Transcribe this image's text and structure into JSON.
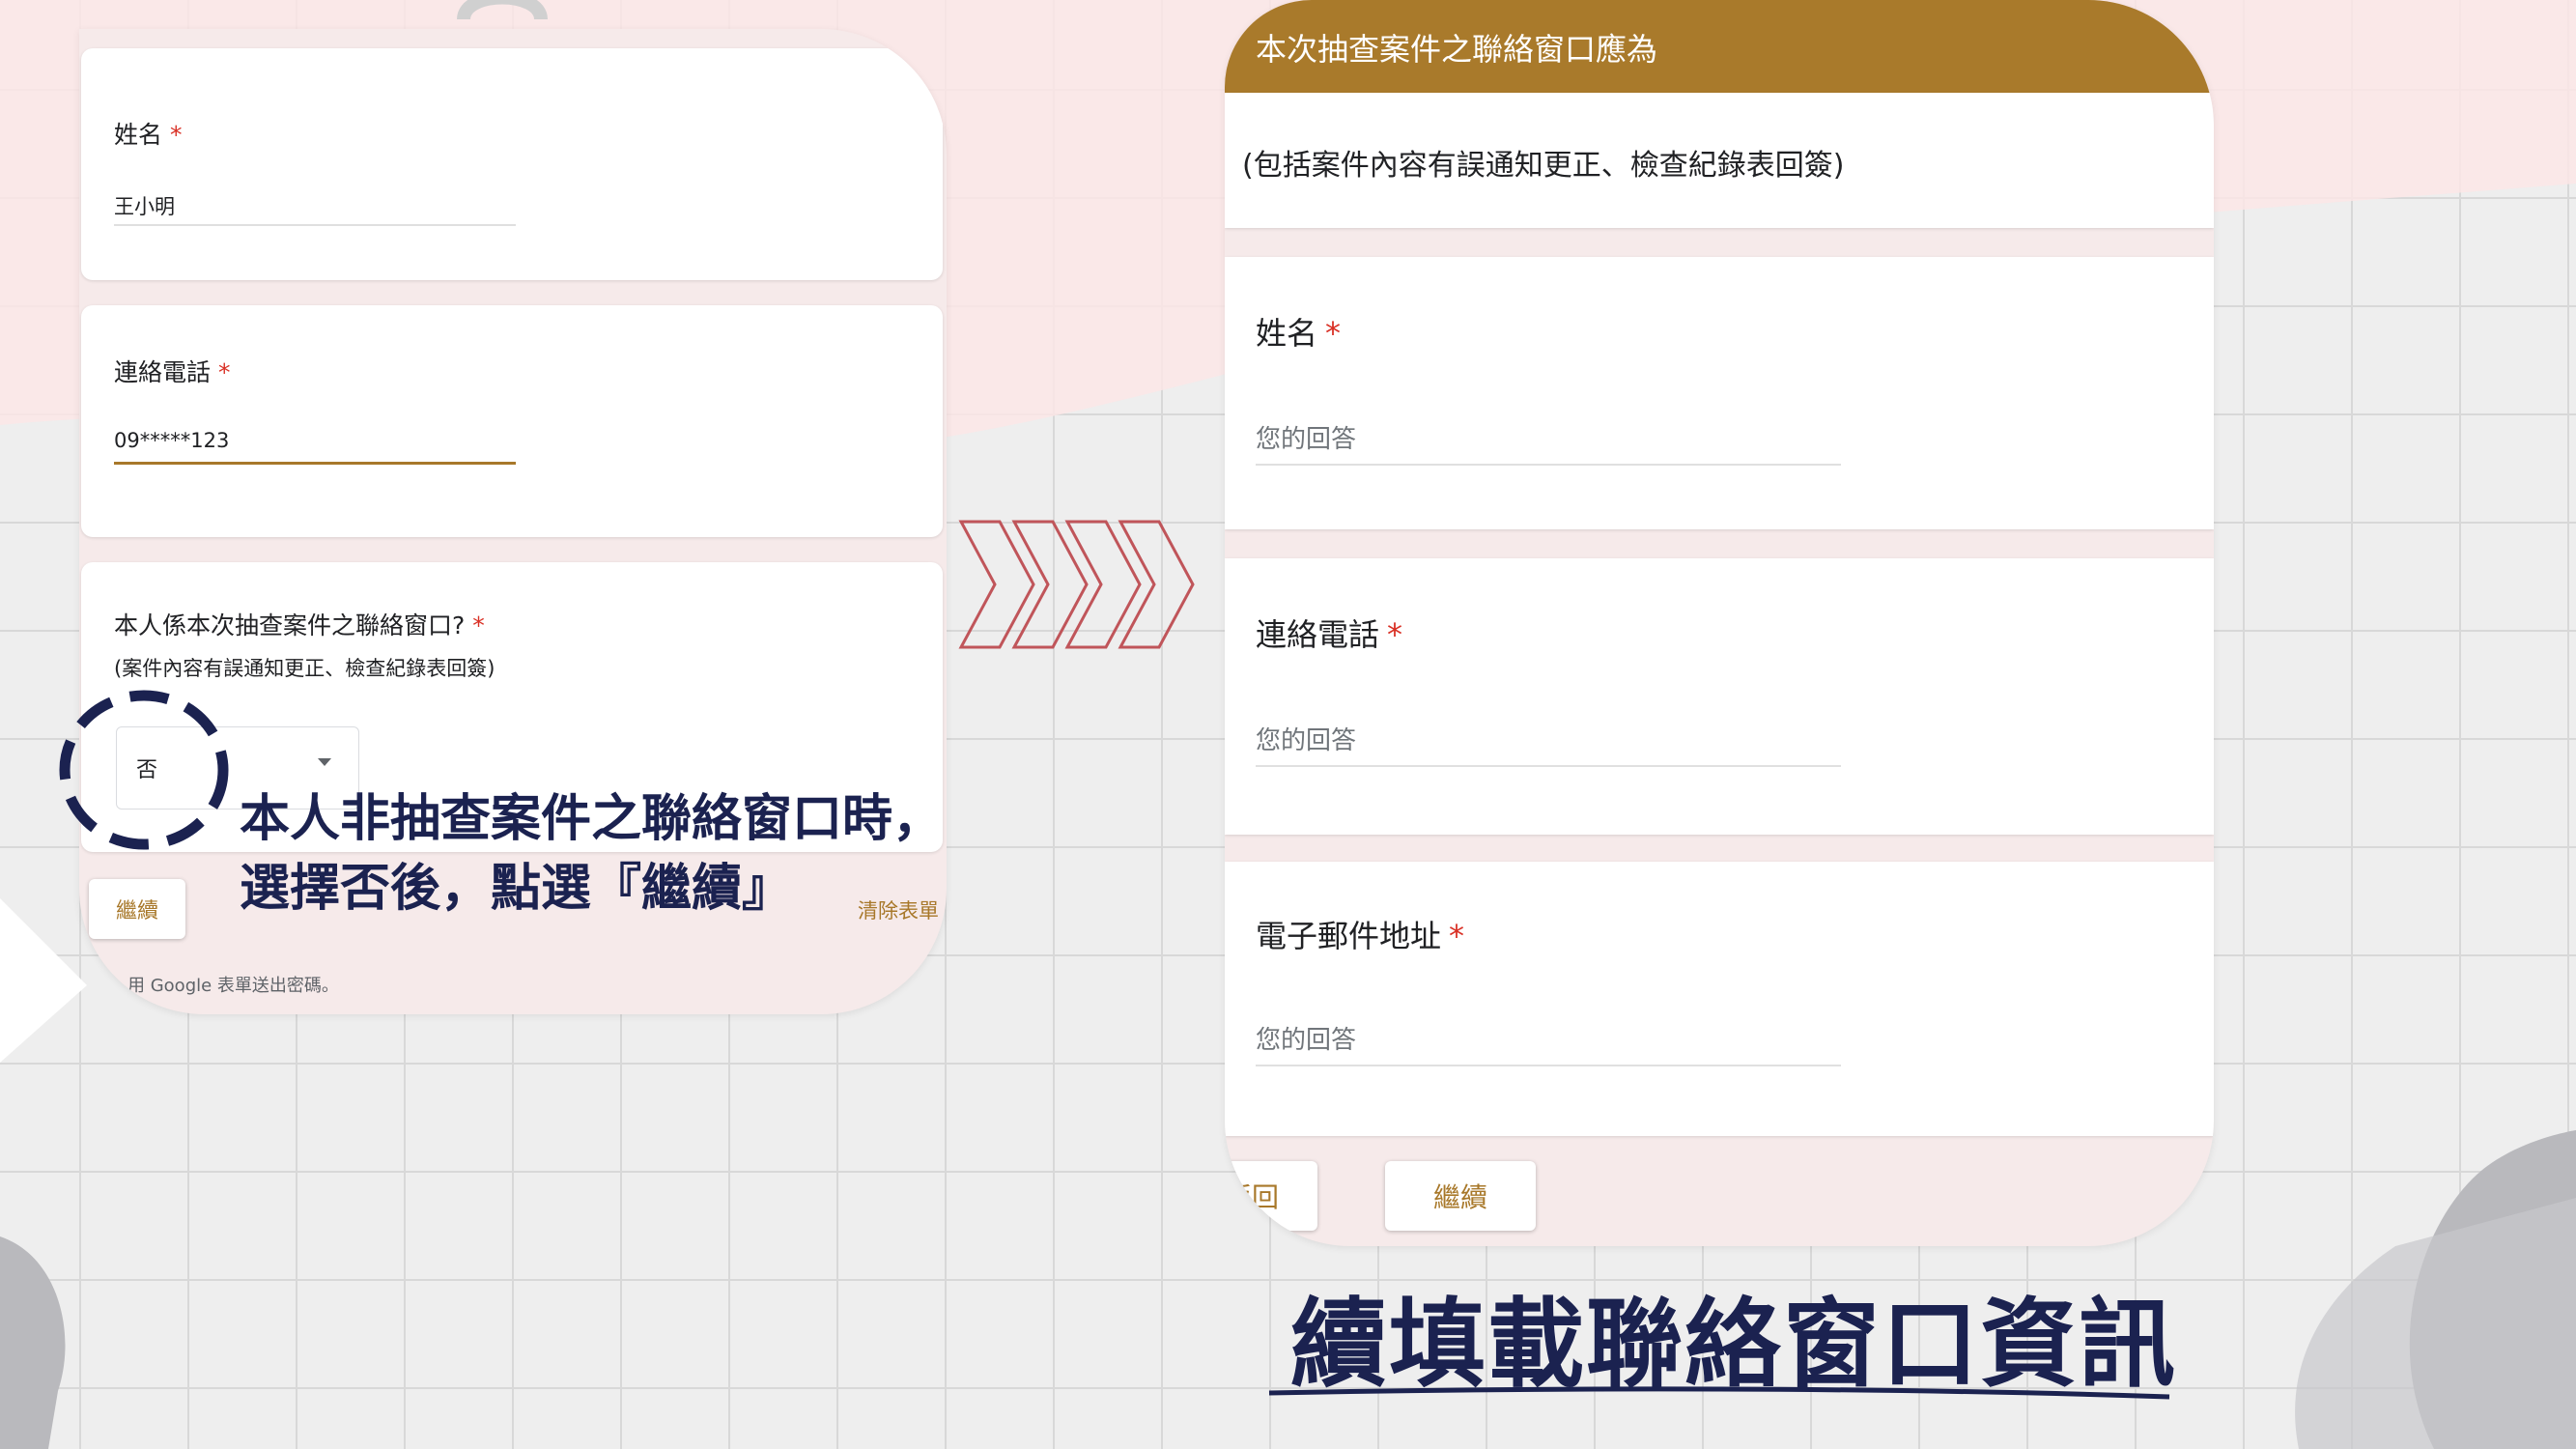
{
  "left_form": {
    "name_label": "姓名",
    "name_value": "王小明",
    "phone_label": "連絡電話",
    "phone_value": "09*****123",
    "question_label": "本人係本次抽查案件之聯絡窗口?",
    "question_note": "(案件內容有誤通知更正、檢查紀錄表回簽)",
    "select_value": "否",
    "continue_label": "繼續",
    "clear_label": "清除表單",
    "footer_text": "用 Google 表單送出密碼。"
  },
  "callout": {
    "line1": "本人非抽查案件之聯絡窗口時，",
    "line2": "選擇否後，點選『繼續』"
  },
  "right_form": {
    "header_title": "本次抽查案件之聯絡窗口應為",
    "header_note": "(包括案件內容有誤通知更正、檢查紀錄表回簽)",
    "name_label": "姓名",
    "phone_label": "連絡電話",
    "email_label": "電子郵件地址",
    "placeholder": "您的回答",
    "back_label": "返回",
    "continue_label": "繼續"
  },
  "caption": "續填載聯絡窗口資訊",
  "colors": {
    "accent": "#a8782a",
    "header": "#a97a2b",
    "required": "#d93025",
    "navy": "#1b2250",
    "arrow": "#c0555a"
  },
  "required_mark": "*"
}
